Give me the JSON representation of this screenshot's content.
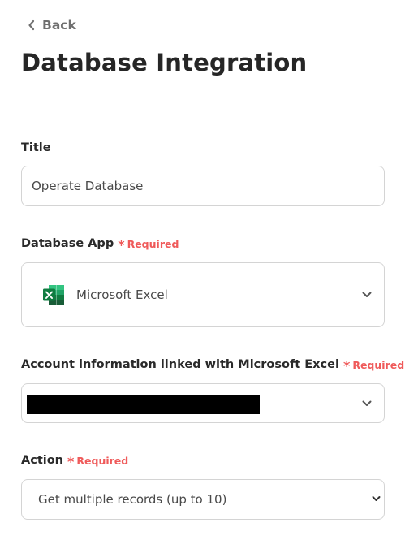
{
  "nav": {
    "back_label": "Back"
  },
  "page": {
    "title": "Database Integration"
  },
  "form": {
    "required_label": "Required",
    "title_field": {
      "label": "Title",
      "value": "Operate Database"
    },
    "database_app": {
      "label": "Database App",
      "selected_app": "Microsoft Excel",
      "app_icon": "microsoft-excel-icon"
    },
    "account": {
      "label": "Account information linked with Microsoft Excel",
      "value_redacted": true
    },
    "action": {
      "label": "Action",
      "selected": "Get multiple records (up to 10)"
    }
  },
  "colors": {
    "required": "#ef5a5a",
    "border": "#d4d4d4",
    "text": "#2a2a2a",
    "muted": "#6f6f6f",
    "excel_green": "#1f7a45"
  }
}
